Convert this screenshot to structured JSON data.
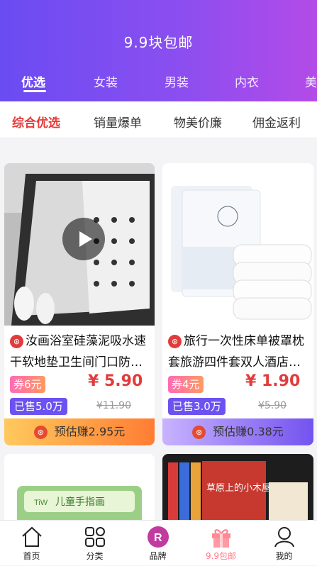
{
  "header": {
    "title": "9.9块包邮",
    "tabs": [
      "优选",
      "女装",
      "男装",
      "内衣",
      "美"
    ]
  },
  "subtabs": [
    "综合优选",
    "销量爆单",
    "物美价廉",
    "佣金返利"
  ],
  "products": [
    {
      "title": "汝画浴室硅藻泥吸水速干软地垫卫生间门口防…",
      "coupon": "券6元",
      "price": "¥ 5.90",
      "sold": "已售5.0万",
      "original_price": "¥11.90",
      "estimated_earn": "预估赚2.95元",
      "earn_gradient": [
        "#ffc95d",
        "#ff7d33"
      ]
    },
    {
      "title": "旅行一次性床单被罩枕套旅游四件套双人酒店…",
      "coupon": "券4元",
      "price": "¥ 1.90",
      "sold": "已售3.0万",
      "original_price": "¥5.90",
      "estimated_earn": "预估赚0.38元",
      "earn_gradient": [
        "#c8b3ff",
        "#7353ef"
      ]
    },
    {
      "label": "儿童手指画"
    },
    {
      "label": "草原上的小木屋"
    }
  ],
  "bottom_nav": [
    {
      "label": "首页",
      "icon": "home-icon"
    },
    {
      "label": "分类",
      "icon": "grid-icon"
    },
    {
      "label": "品牌",
      "icon": "brand-r-icon"
    },
    {
      "label": "9.9包邮",
      "icon": "gift-icon",
      "active": true
    },
    {
      "label": "我的",
      "icon": "profile-icon"
    }
  ],
  "brand_letter": "R",
  "colors": {
    "accent": "#6a4cf2",
    "price": "#e23b3b",
    "active_nav": "#ff7c8b"
  }
}
